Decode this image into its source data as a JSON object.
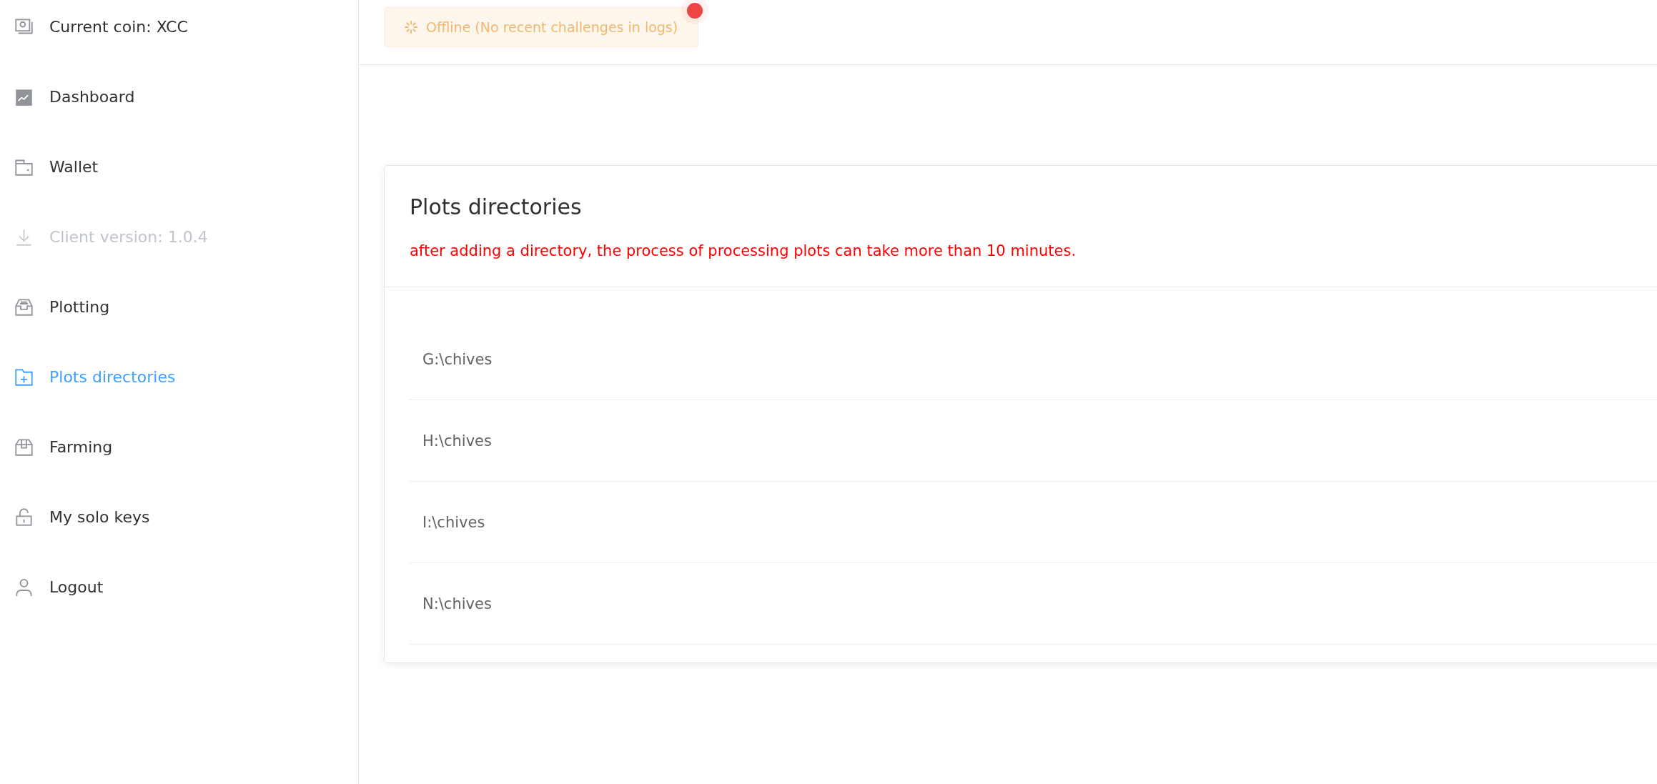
{
  "sidebar": {
    "items": [
      {
        "label": "Current coin: XCC",
        "selected": false,
        "disabled": false
      },
      {
        "label": "Dashboard",
        "selected": false,
        "disabled": false
      },
      {
        "label": "Wallet",
        "selected": false,
        "disabled": false
      },
      {
        "label": "Client version: 1.0.4",
        "selected": false,
        "disabled": true
      },
      {
        "label": "Plotting",
        "selected": false,
        "disabled": false
      },
      {
        "label": "Plots directories",
        "selected": true,
        "disabled": false
      },
      {
        "label": "Farming",
        "selected": false,
        "disabled": false
      },
      {
        "label": "My solo keys",
        "selected": false,
        "disabled": false
      },
      {
        "label": "Logout",
        "selected": false,
        "disabled": false
      }
    ]
  },
  "status_badge": {
    "text": "Offline (No recent challenges in logs)"
  },
  "card": {
    "title": "Plots directories",
    "warning": "after adding a directory, the process of processing plots can take more than 10 minutes.",
    "rows": [
      "G:\\chives",
      "H:\\chives",
      "I:\\chives",
      "N:\\chives"
    ]
  }
}
